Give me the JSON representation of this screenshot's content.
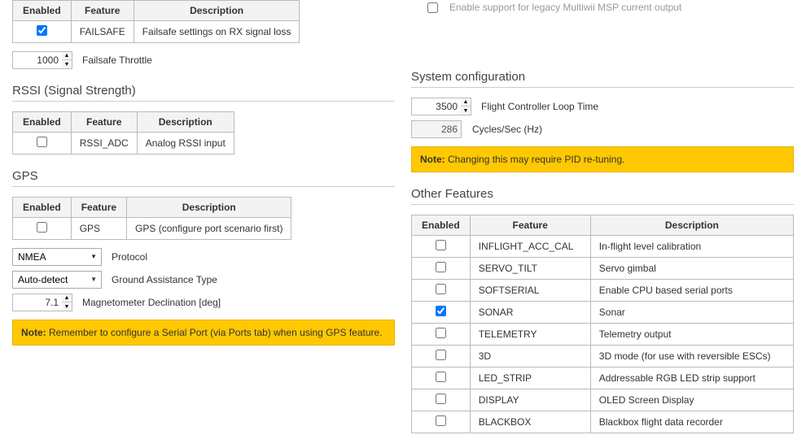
{
  "top_right": {
    "legacy_label": "Enable support for legacy Multiwii MSP current output"
  },
  "failsafe": {
    "headers": [
      "Enabled",
      "Feature",
      "Description"
    ],
    "row": {
      "feature": "FAILSAFE",
      "description": "Failsafe settings on RX signal loss"
    },
    "throttle_value": "1000",
    "throttle_label": "Failsafe Throttle"
  },
  "rssi": {
    "title": "RSSI (Signal Strength)",
    "headers": [
      "Enabled",
      "Feature",
      "Description"
    ],
    "row": {
      "feature": "RSSI_ADC",
      "description": "Analog RSSI input"
    }
  },
  "gps": {
    "title": "GPS",
    "headers": [
      "Enabled",
      "Feature",
      "Description"
    ],
    "row": {
      "feature": "GPS",
      "description": "GPS (configure port scenario first)"
    },
    "protocol_value": "NMEA",
    "protocol_label": "Protocol",
    "ground_value": "Auto-detect",
    "ground_label": "Ground Assistance Type",
    "mag_value": "7.1",
    "mag_label": "Magnetometer Declination [deg]",
    "note_bold": "Note:",
    "note_text": " Remember to configure a Serial Port (via Ports tab) when using GPS feature."
  },
  "system": {
    "title": "System configuration",
    "loop_value": "3500",
    "loop_label": "Flight Controller Loop Time",
    "cycles_value": "286",
    "cycles_label": "Cycles/Sec (Hz)",
    "note_bold": "Note:",
    "note_text": " Changing this may require PID re-tuning."
  },
  "other": {
    "title": "Other Features",
    "headers": [
      "Enabled",
      "Feature",
      "Description"
    ],
    "rows": [
      {
        "checked": false,
        "feature": "INFLIGHT_ACC_CAL",
        "description": "In-flight level calibration"
      },
      {
        "checked": false,
        "feature": "SERVO_TILT",
        "description": "Servo gimbal"
      },
      {
        "checked": false,
        "feature": "SOFTSERIAL",
        "description": "Enable CPU based serial ports"
      },
      {
        "checked": true,
        "feature": "SONAR",
        "description": "Sonar"
      },
      {
        "checked": false,
        "feature": "TELEMETRY",
        "description": "Telemetry output"
      },
      {
        "checked": false,
        "feature": "3D",
        "description": "3D mode (for use with reversible ESCs)"
      },
      {
        "checked": false,
        "feature": "LED_STRIP",
        "description": "Addressable RGB LED strip support"
      },
      {
        "checked": false,
        "feature": "DISPLAY",
        "description": "OLED Screen Display"
      },
      {
        "checked": false,
        "feature": "BLACKBOX",
        "description": "Blackbox flight data recorder"
      }
    ]
  }
}
